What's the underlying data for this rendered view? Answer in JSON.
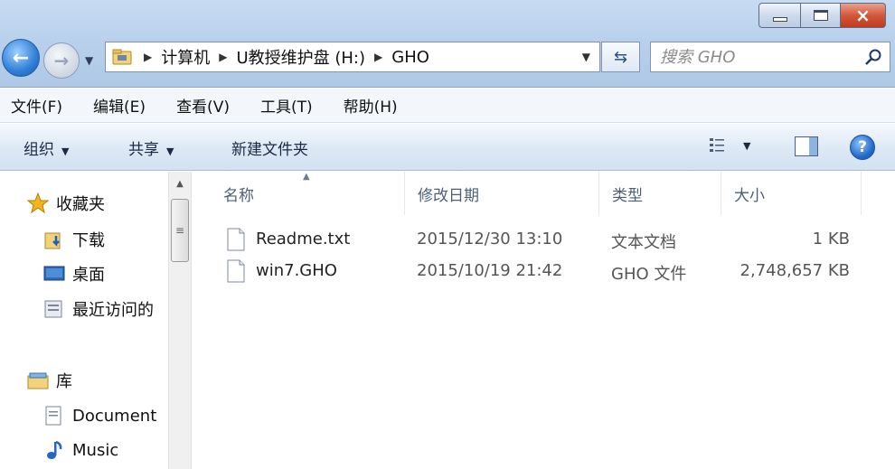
{
  "window": {
    "minimize_label": "",
    "maximize_label": "",
    "close_label": "×"
  },
  "address": {
    "crumbs": [
      "计算机",
      "U教授维护盘 (H:)",
      "GHO"
    ]
  },
  "search": {
    "placeholder": "搜索 GHO"
  },
  "menu": [
    "文件(F)",
    "编辑(E)",
    "查看(V)",
    "工具(T)",
    "帮助(H)"
  ],
  "toolbar": {
    "organize": "组织",
    "share": "共享",
    "new_folder": "新建文件夹"
  },
  "nav": {
    "favorites": "收藏夹",
    "downloads": "下载",
    "desktop": "桌面",
    "recent": "最近访问的",
    "libraries": "库",
    "documents": "Document",
    "music": "Music"
  },
  "columns": {
    "name": "名称",
    "modified": "修改日期",
    "type": "类型",
    "size": "大小"
  },
  "files": [
    {
      "name": "Readme.txt",
      "modified": "2015/12/30 13:10",
      "type": "文本文档",
      "size": "1 KB"
    },
    {
      "name": "win7.GHO",
      "modified": "2015/10/19 21:42",
      "type": "GHO 文件",
      "size": "2,748,657 KB"
    }
  ],
  "colors": {
    "titlebar": "#b9d1ec",
    "close_button": "#c13a1c",
    "accent": "#2e7ed8"
  }
}
